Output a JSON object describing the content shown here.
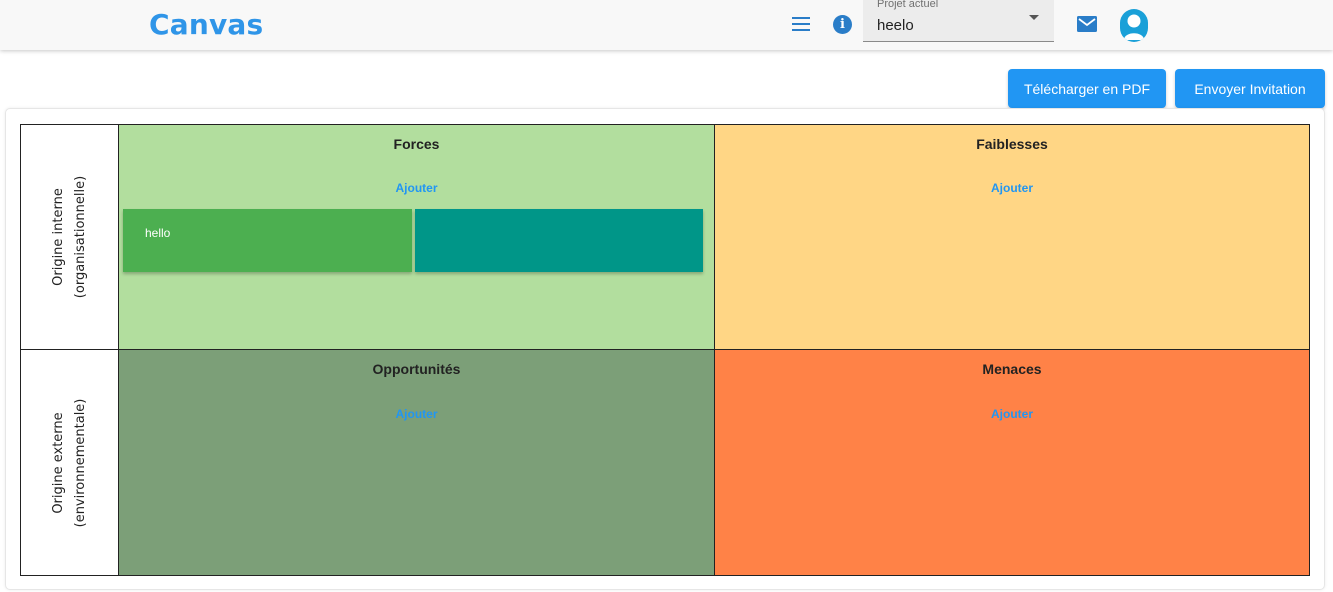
{
  "header": {
    "app_title": "Canvas",
    "project_label": "Projet actuel",
    "project_value": "heelo",
    "icons": [
      "menu-icon",
      "info-icon",
      "mail-icon",
      "user-icon"
    ]
  },
  "actions": {
    "pdf_label": "Télécharger en PDF",
    "invite_label": "Envoyer Invitation"
  },
  "rows": [
    {
      "line1": "Origine interne",
      "line2": "(organisationnelle)"
    },
    {
      "line1": "Origine externe",
      "line2": "(environnementale)"
    }
  ],
  "quadrants": {
    "forces": {
      "title": "Forces",
      "add_label": "Ajouter",
      "color": "#b2de9e",
      "notes": [
        {
          "text": "hello",
          "color": "#4caf50"
        },
        {
          "text": "",
          "color": "#009688"
        }
      ]
    },
    "faiblesses": {
      "title": "Faiblesses",
      "add_label": "Ajouter",
      "color": "#ffd685"
    },
    "opportunites": {
      "title": "Opportunités",
      "add_label": "Ajouter",
      "color": "#7c9f78"
    },
    "menaces": {
      "title": "Menaces",
      "add_label": "Ajouter",
      "color": "#ff8247"
    }
  },
  "accent_color": "#2196f3"
}
